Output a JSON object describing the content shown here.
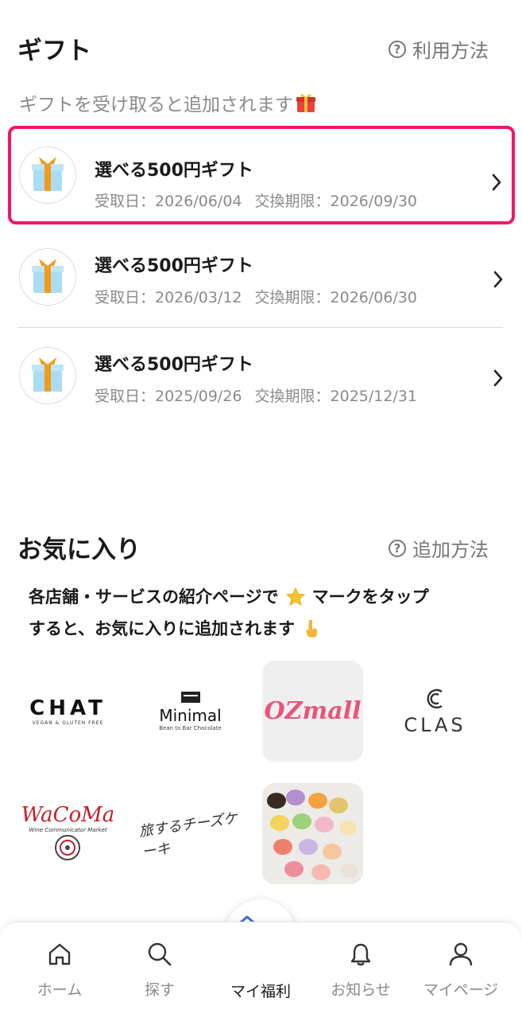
{
  "gift": {
    "title": "ギフト",
    "help_label": "利用方法",
    "subtitle": "ギフトを受け取ると追加されます",
    "items": [
      {
        "name": "選べる500円ギフト",
        "received": "受取日：2026/06/04",
        "expires": "交換期限：2026/09/30",
        "highlighted": true
      },
      {
        "name": "選べる500円ギフト",
        "received": "受取日：2026/03/12",
        "expires": "交換期限：2026/06/30",
        "highlighted": false
      },
      {
        "name": "選べる500円ギフト",
        "received": "受取日：2025/09/26",
        "expires": "交換期限：2025/12/31",
        "highlighted": false
      }
    ]
  },
  "favorites": {
    "title": "お気に入り",
    "help_label": "追加方法",
    "desc_line1_a": "各店舗・サービスの紹介ページで",
    "desc_line1_b": "マークをタップ",
    "desc_line2": "すると、お気に入りに追加されます",
    "logos": [
      {
        "name": "CHAT",
        "sub": "VEGAN & GLUTEN FREE"
      },
      {
        "name": "Minimal",
        "sub": "Bean to Bar Chocolate"
      },
      {
        "name": "OZmall"
      },
      {
        "name": "CLAS"
      },
      {
        "name": "WaCoMa",
        "sub": "Wine Communicator Market"
      },
      {
        "name": "旅するチーズケーキ"
      },
      {
        "name": "macaron-photo"
      }
    ]
  },
  "nav": {
    "home": "ホーム",
    "search": "探す",
    "my_welfare": "マイ福利",
    "notifications": "お知らせ",
    "mypage": "マイページ"
  },
  "colors": {
    "highlight": "#f0176b",
    "gift_ribbon": "#f39a1a",
    "gift_box": "#a9dcf5",
    "ozmall": "#e8557a"
  }
}
